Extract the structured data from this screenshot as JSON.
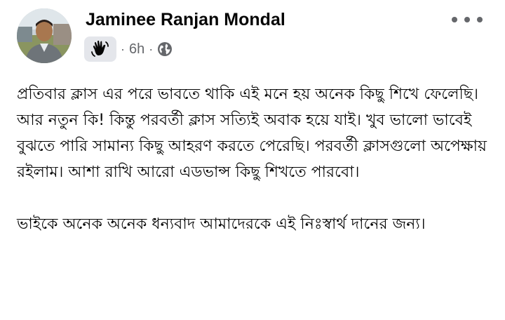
{
  "post": {
    "author": "Jaminee Ranjan Mondal",
    "separator": "·",
    "time": "6h",
    "badge_icon": "waving-hand-icon",
    "audience_icon": "globe-icon",
    "menu_icon": "more-options-icon",
    "paragraphs": [
      "প্রতিবার ক্লাস এর পরে ভাবতে থাকি এই মনে হয় অনেক কিছু শিখে ফেলেছি। আর নতুন কি! কিন্তু পরবর্তী ক্লাস সত্যিই অবাক হয়ে যাই। খুব ভালো ভাবেই বুঝতে পারি সামান্য কিছু আহরণ করতে পেরেছি। পরবর্তী ক্লাসগুলো অপেক্ষায় রইলাম। আশা রাখি আরো এডভান্স কিছু শিখতে পারবো।",
      "ভাইকে অনেক অনেক ধন্যবাদ আমাদেরকে এই নিঃস্বার্থ দানের জন্য।"
    ]
  },
  "colors": {
    "text": "#050505",
    "secondary_text": "#65676b",
    "badge_background": "#e4e6eb",
    "background": "#ffffff"
  }
}
